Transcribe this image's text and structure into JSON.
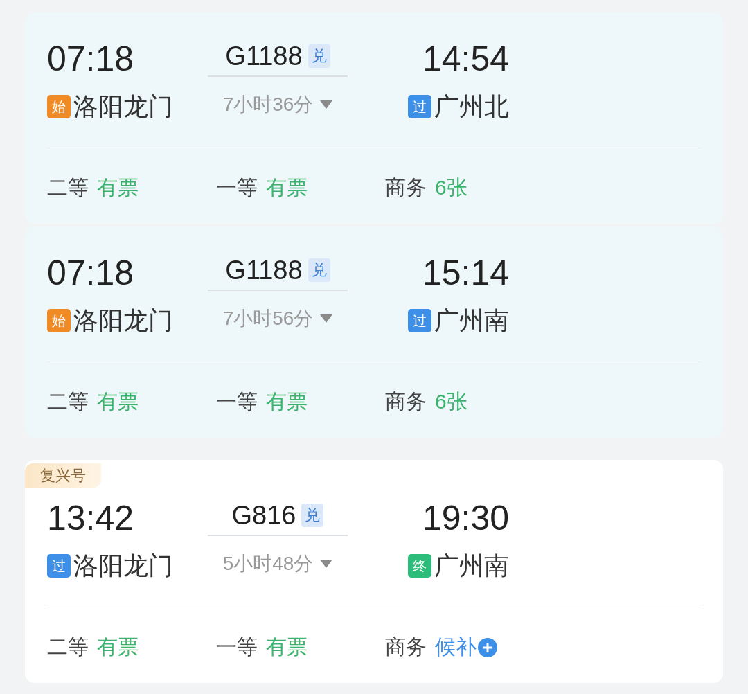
{
  "trains": [
    {
      "highlighted": true,
      "depart_time": "07:18",
      "train_no": "G1188",
      "exchange_badge": "兑",
      "arrive_time": "14:54",
      "from": {
        "tag": "始",
        "kind": "origin",
        "name": "洛阳龙门"
      },
      "duration": "7小时36分",
      "to": {
        "tag": "过",
        "kind": "pass",
        "name": "广州北"
      },
      "seats": [
        {
          "class": "二等",
          "status": "有票",
          "kind": "available"
        },
        {
          "class": "一等",
          "status": "有票",
          "kind": "available"
        },
        {
          "class": "商务",
          "status": "6张",
          "kind": "available"
        }
      ]
    },
    {
      "highlighted": true,
      "depart_time": "07:18",
      "train_no": "G1188",
      "exchange_badge": "兑",
      "arrive_time": "15:14",
      "from": {
        "tag": "始",
        "kind": "origin",
        "name": "洛阳龙门"
      },
      "duration": "7小时56分",
      "to": {
        "tag": "过",
        "kind": "pass",
        "name": "广州南"
      },
      "seats": [
        {
          "class": "二等",
          "status": "有票",
          "kind": "available"
        },
        {
          "class": "一等",
          "status": "有票",
          "kind": "available"
        },
        {
          "class": "商务",
          "status": "6张",
          "kind": "available"
        }
      ]
    },
    {
      "highlighted": false,
      "label": "复兴号",
      "depart_time": "13:42",
      "train_no": "G816",
      "exchange_badge": "兑",
      "arrive_time": "19:30",
      "from": {
        "tag": "过",
        "kind": "pass",
        "name": "洛阳龙门"
      },
      "duration": "5小时48分",
      "to": {
        "tag": "终",
        "kind": "terminal",
        "name": "广州南"
      },
      "seats": [
        {
          "class": "二等",
          "status": "有票",
          "kind": "available"
        },
        {
          "class": "一等",
          "status": "有票",
          "kind": "available"
        },
        {
          "class": "商务",
          "status": "候补",
          "kind": "waitlist"
        }
      ]
    }
  ]
}
